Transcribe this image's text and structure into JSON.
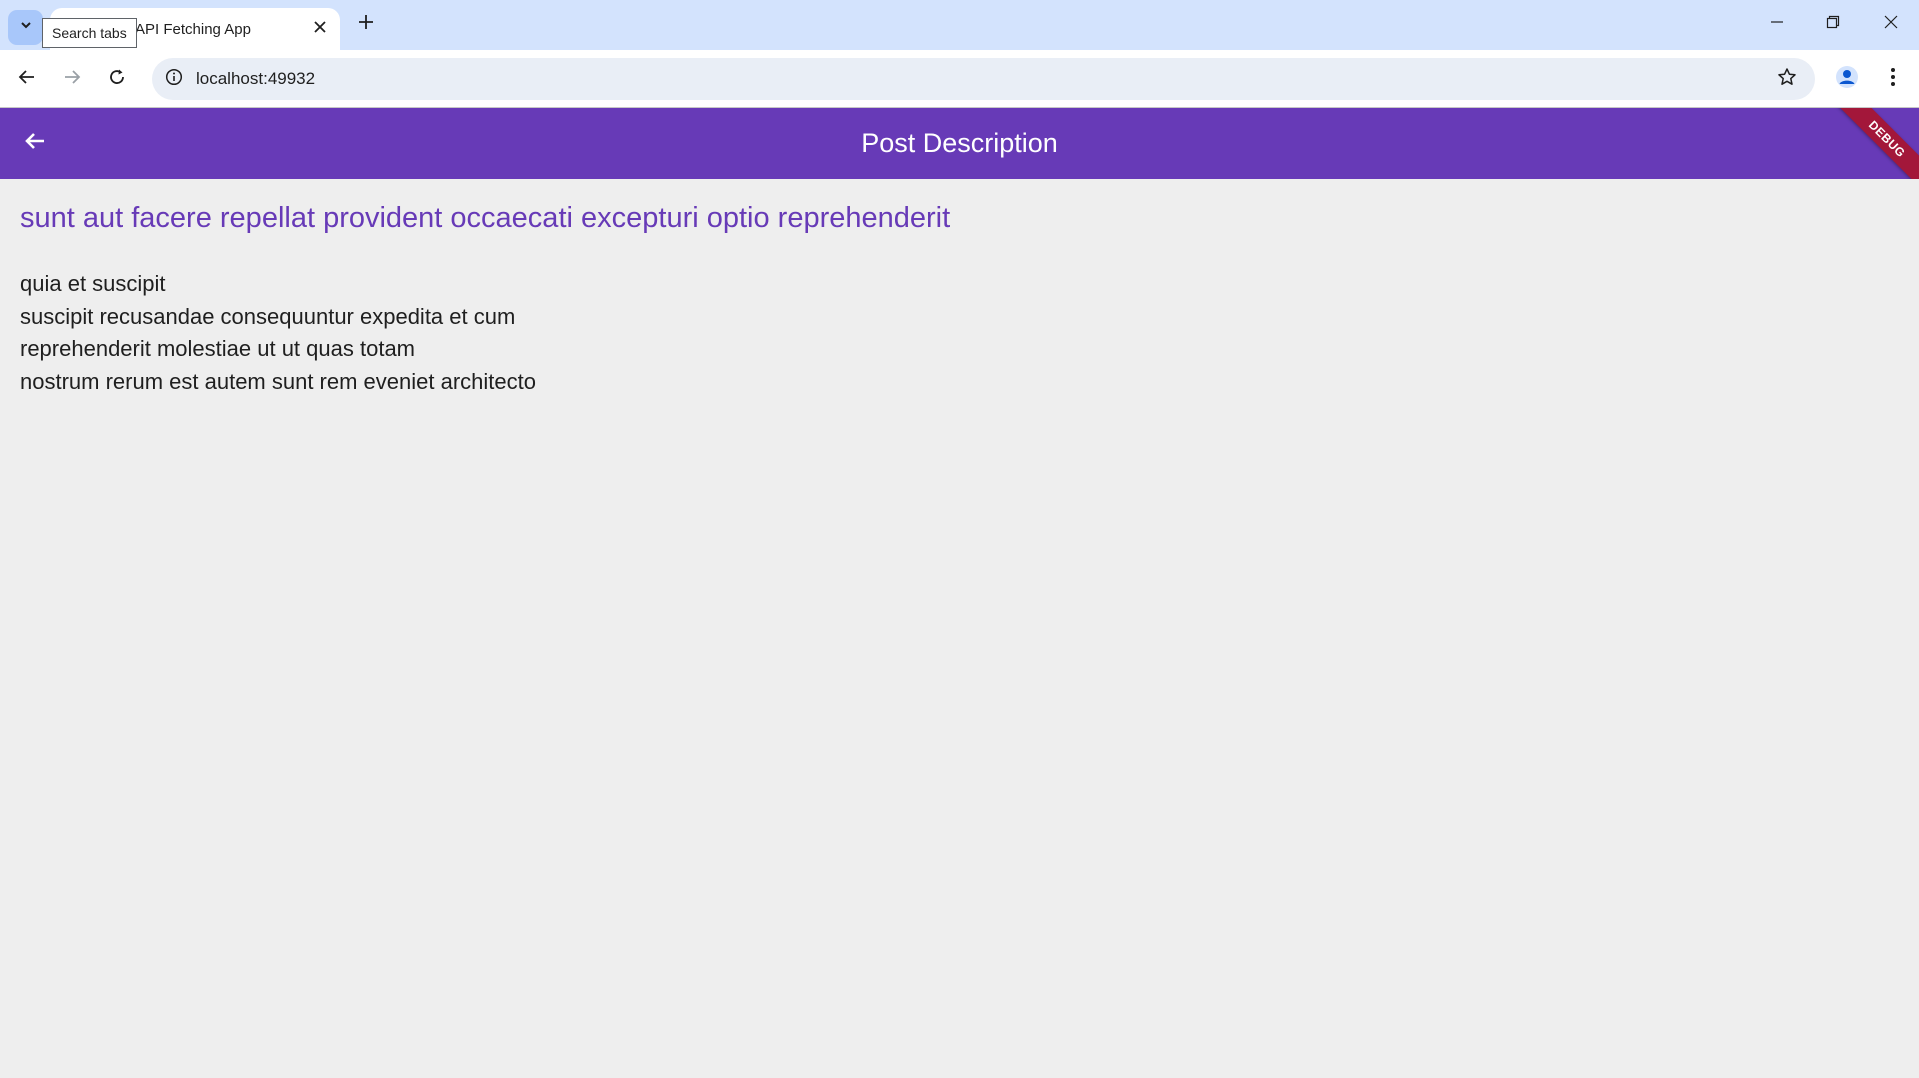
{
  "browser": {
    "tab_title": "API Fetching App",
    "tooltip": "Search tabs",
    "url": "localhost:49932",
    "icons": {
      "tab_search": "chevron-down-icon",
      "tab_close": "close-icon",
      "new_tab": "plus-icon",
      "minimize": "minimize-icon",
      "restore": "restore-icon",
      "close_window": "close-icon",
      "back": "arrow-left-icon",
      "forward": "arrow-right-icon",
      "reload": "reload-icon",
      "site_info": "info-icon",
      "bookmark": "star-icon",
      "profile": "avatar-icon",
      "menu": "kebab-menu-icon"
    }
  },
  "app": {
    "appbar": {
      "title": "Post Description",
      "back_icon": "arrow-left-icon"
    },
    "debug_banner": "DEBUG",
    "post": {
      "title": "sunt aut facere repellat provident occaecati excepturi optio reprehenderit",
      "body": "quia et suscipit\nsuscipit recusandae consequuntur expedita et cum\nreprehenderit molestiae ut ut quas totam\nnostrum rerum est autem sunt rem eveniet architecto"
    }
  },
  "colors": {
    "appbar": "#673ab7",
    "title_text": "#673ab7",
    "background": "#eeeeee",
    "tabstrip": "#d3e3fd",
    "debug_banner": "#a3173a"
  }
}
